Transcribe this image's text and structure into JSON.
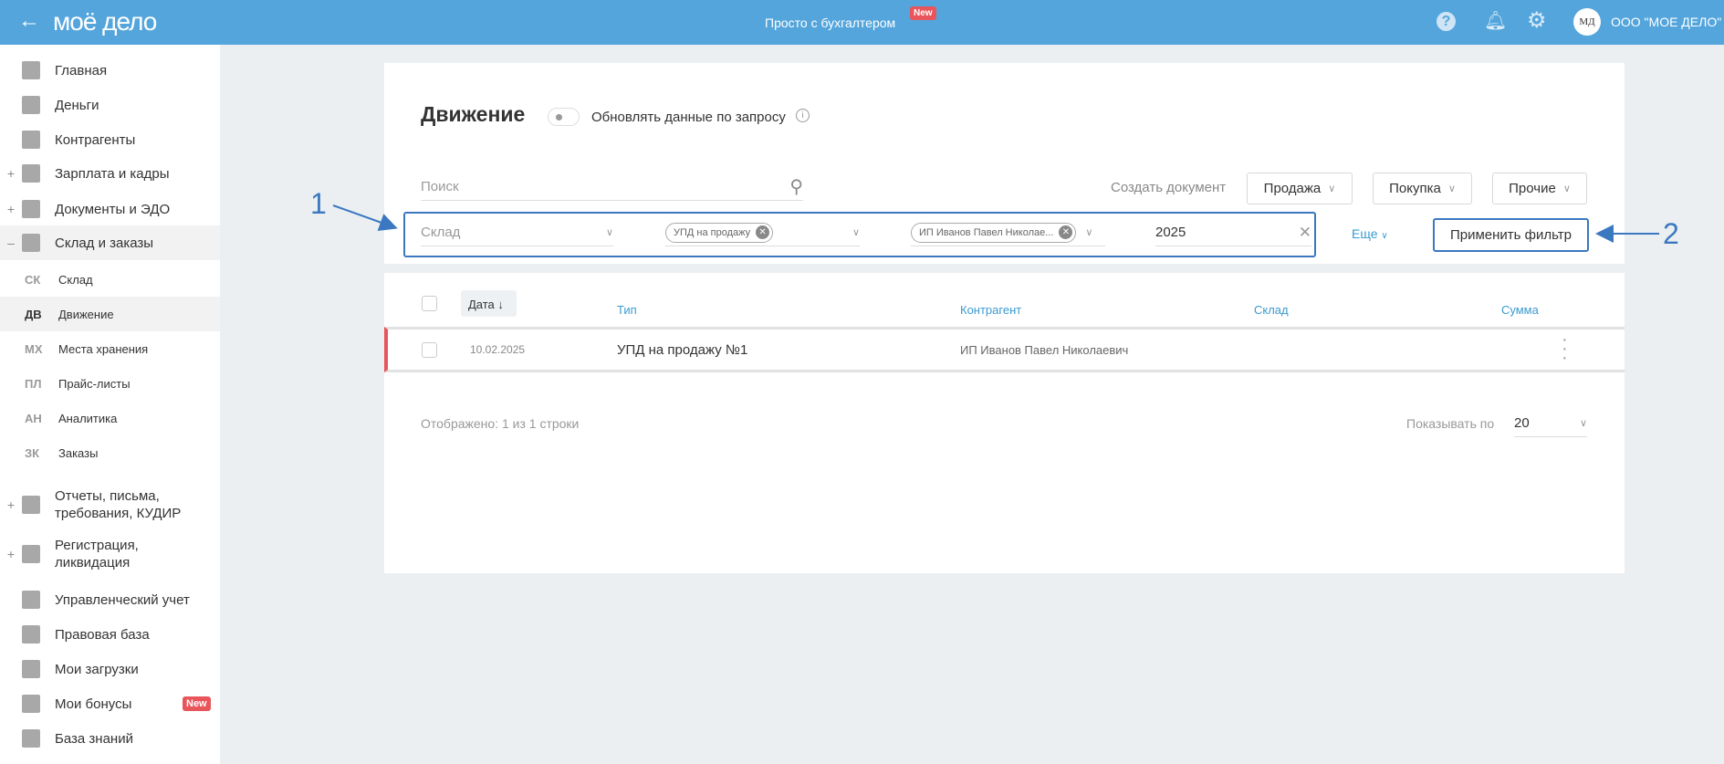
{
  "header": {
    "logo": "моё дело",
    "center_link": "Просто с бухгалтером",
    "center_badge": "New",
    "avatar_initials": "МД",
    "company": "ООО \"МОЕ ДЕЛО\"",
    "accent": "#53a5dc"
  },
  "sidebar": {
    "items": [
      {
        "label": "Главная",
        "icon": "home-icon",
        "expand": ""
      },
      {
        "label": "Деньги",
        "icon": "money-icon",
        "expand": ""
      },
      {
        "label": "Контрагенты",
        "icon": "person-icon",
        "expand": ""
      },
      {
        "label": "Зарплата и кадры",
        "icon": "wallet-icon",
        "expand": "+"
      },
      {
        "label": "Документы и ЭДО",
        "icon": "docs-icon",
        "expand": "+"
      },
      {
        "label": "Склад и заказы",
        "icon": "warehouse-icon",
        "expand": "–"
      }
    ],
    "subitems": [
      {
        "abbr": "СК",
        "label": "Склад"
      },
      {
        "abbr": "ДВ",
        "label": "Движение"
      },
      {
        "abbr": "МХ",
        "label": "Места хранения"
      },
      {
        "abbr": "ПЛ",
        "label": "Прайс-листы"
      },
      {
        "abbr": "АН",
        "label": "Аналитика"
      },
      {
        "abbr": "ЗК",
        "label": "Заказы"
      }
    ],
    "bottom": [
      {
        "label": "Отчеты, письма, требования, КУДИР",
        "icon": "report-icon",
        "expand": "+"
      },
      {
        "label": "Регистрация, ликвидация",
        "icon": "registration-icon",
        "expand": "+"
      },
      {
        "label": "Управленческий учет",
        "icon": "ruble-icon",
        "expand": ""
      },
      {
        "label": "Правовая база",
        "icon": "briefcase-icon",
        "expand": ""
      },
      {
        "label": "Мои загрузки",
        "icon": "folder-icon",
        "expand": ""
      },
      {
        "label": "Мои бонусы",
        "icon": "gift-icon",
        "expand": "",
        "badge": "New"
      },
      {
        "label": "База знаний",
        "icon": "graduation-icon",
        "expand": ""
      }
    ]
  },
  "page": {
    "title": "Движение",
    "toggle_label": "Обновлять данные по запросу",
    "search_placeholder": "Поиск",
    "create_label": "Создать документ",
    "create_buttons": [
      "Продажа",
      "Покупка",
      "Прочие"
    ],
    "filters": {
      "warehouse_placeholder": "Склад",
      "type_chip": "УПД на продажу",
      "counterparty_chip": "ИП Иванов Павел Николае...",
      "year": "2025",
      "more": "Еще",
      "apply": "Применить фильтр"
    }
  },
  "annotations": [
    "1",
    "2"
  ],
  "table": {
    "columns": [
      "Дата",
      "Тип",
      "Контрагент",
      "Склад",
      "Сумма"
    ],
    "sort_arrow": "↓",
    "rows": [
      {
        "date": "10.02.2025",
        "type": "УПД на продажу №1",
        "counterparty": "ИП Иванов Павел Николаевич",
        "warehouse": "",
        "sum": ""
      }
    ],
    "footer": {
      "shown": "Отображено: 1 из 1 строки",
      "per_page_label": "Показывать по",
      "per_page": "20"
    }
  }
}
